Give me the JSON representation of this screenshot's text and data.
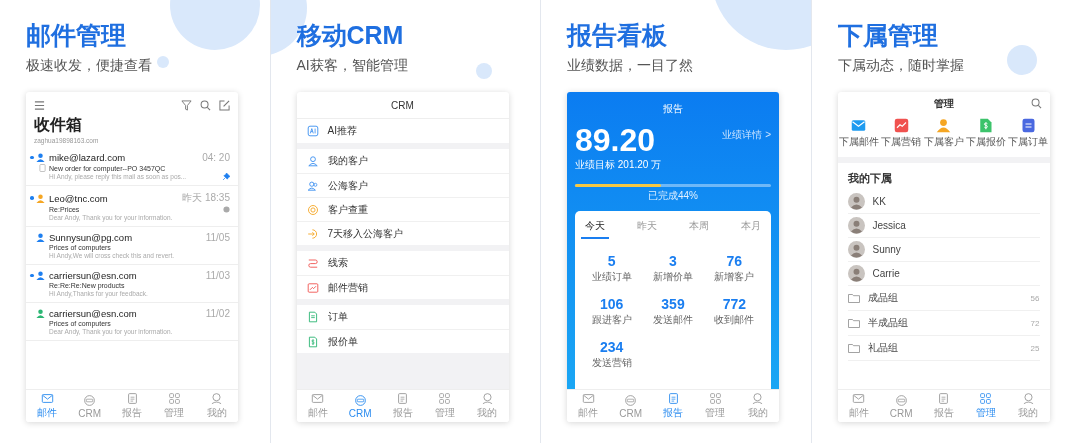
{
  "panels": [
    {
      "kind": "mail",
      "title": "邮件管理",
      "subtitle": "极速收发，便捷查看",
      "screen": {
        "heading": "收件箱",
        "account": "zaghua19898163.com",
        "emails": [
          {
            "sender": "mike@lazard.com",
            "time": "04: 20",
            "subject": "New order for  computer--PO  3457QC",
            "preview": "Hi Andy, please reply this mail as soon as  pos...",
            "unread": true,
            "color": "#1e7ff0",
            "attachment": true,
            "pinned": true,
            "marked": false
          },
          {
            "sender": "Leo@tnc.com",
            "time": "昨天 18:35",
            "subject": "Re:Prices",
            "preview": "Dear Andy, Thank you for your information.",
            "unread": true,
            "color": "#f5a623",
            "attachment": false,
            "pinned": false,
            "marked": true
          },
          {
            "sender": "Sunnysun@pg.com",
            "time": "11/05",
            "subject": "Prices of computers",
            "preview": "Hi Andy,We will cross check this and revert.",
            "unread": false,
            "color": "#1e7ff0",
            "attachment": false,
            "pinned": false,
            "marked": false
          },
          {
            "sender": "carriersun@esn.com",
            "time": "11/03",
            "subject": "Re:Re:Re:New products",
            "preview": "Hi Andy,Thanks for your feedback.",
            "unread": true,
            "color": "#1e7ff0",
            "attachment": false,
            "pinned": false,
            "marked": false
          },
          {
            "sender": "carriersun@esn.com",
            "time": "11/02",
            "subject": "Prices of computers",
            "preview": "Dear Andy, Thank you for your information.",
            "unread": false,
            "color": "#2bb673",
            "attachment": false,
            "pinned": false,
            "marked": false
          }
        ]
      },
      "tab_bar": [
        {
          "label": "邮件",
          "selected": true
        },
        {
          "label": "CRM",
          "selected": false
        },
        {
          "label": "报告",
          "selected": false
        },
        {
          "label": "管理",
          "selected": false
        },
        {
          "label": "我的",
          "selected": false
        }
      ]
    },
    {
      "kind": "crm",
      "title": "移动CRM",
      "subtitle": "AI获客，智能管理",
      "screen": {
        "heading": "CRM",
        "groups": [
          {
            "items": [
              "AI推荐"
            ]
          },
          {
            "items": [
              "我的客户",
              "公海客户",
              "客户查重",
              "7天移入公海客户"
            ]
          },
          {
            "items": [
              "线索",
              "邮件营销"
            ]
          },
          {
            "items": [
              "订单",
              "报价单"
            ]
          }
        ]
      },
      "tab_bar": [
        {
          "label": "邮件",
          "selected": false
        },
        {
          "label": "CRM",
          "selected": true
        },
        {
          "label": "报告",
          "selected": false
        },
        {
          "label": "管理",
          "selected": false
        },
        {
          "label": "我的",
          "selected": false
        }
      ]
    },
    {
      "kind": "report",
      "title": "报告看板",
      "subtitle": "业绩数据，一目了然",
      "screen": {
        "heading": "报告",
        "amount": "89.20",
        "target": "业绩目标 201.20 万",
        "detail_link": "业绩详情 >",
        "level": 0.44,
        "progress_label": "已完成44%",
        "periods": [
          {
            "label": "今天",
            "selected": true
          },
          {
            "label": "昨天",
            "selected": false
          },
          {
            "label": "本周",
            "selected": false
          },
          {
            "label": "本月",
            "selected": false
          }
        ],
        "stats": [
          {
            "value": "5",
            "label": "业绩订单"
          },
          {
            "value": "3",
            "label": "新增价单"
          },
          {
            "value": "76",
            "label": "新增客户"
          },
          {
            "value": "106",
            "label": "跟进客户"
          },
          {
            "value": "359",
            "label": "发送邮件"
          },
          {
            "value": "772",
            "label": "收到邮件"
          },
          {
            "value": "234",
            "label": "发送营销"
          }
        ]
      },
      "tab_bar": [
        {
          "label": "邮件",
          "selected": false
        },
        {
          "label": "CRM",
          "selected": false
        },
        {
          "label": "报告",
          "selected": true
        },
        {
          "label": "管理",
          "selected": false
        },
        {
          "label": "我的",
          "selected": false
        }
      ]
    },
    {
      "kind": "team",
      "title": "下属管理",
      "subtitle": "下属动态，随时掌握",
      "screen": {
        "heading": "管理",
        "shortcuts": [
          {
            "label": "下属邮件",
            "color": "#1e9bf0"
          },
          {
            "label": "下属营销",
            "color": "#f0524f"
          },
          {
            "label": "下属客户",
            "color": "#f5a623"
          },
          {
            "label": "下属报价",
            "color": "#3cc36b"
          },
          {
            "label": "下属订单",
            "color": "#4a68e0"
          }
        ],
        "section": "我的下属",
        "people": [
          "KK",
          "Jessica",
          "Sunny",
          "Carrie"
        ],
        "folders": [
          {
            "name": "成品组",
            "count": "56"
          },
          {
            "name": "半成品组",
            "count": "72"
          },
          {
            "name": "礼品组",
            "count": "25"
          }
        ]
      },
      "tab_bar": [
        {
          "label": "邮件",
          "selected": false
        },
        {
          "label": "CRM",
          "selected": false
        },
        {
          "label": "报告",
          "selected": false
        },
        {
          "label": "管理",
          "selected": true
        },
        {
          "label": "我的",
          "selected": false
        }
      ]
    }
  ]
}
